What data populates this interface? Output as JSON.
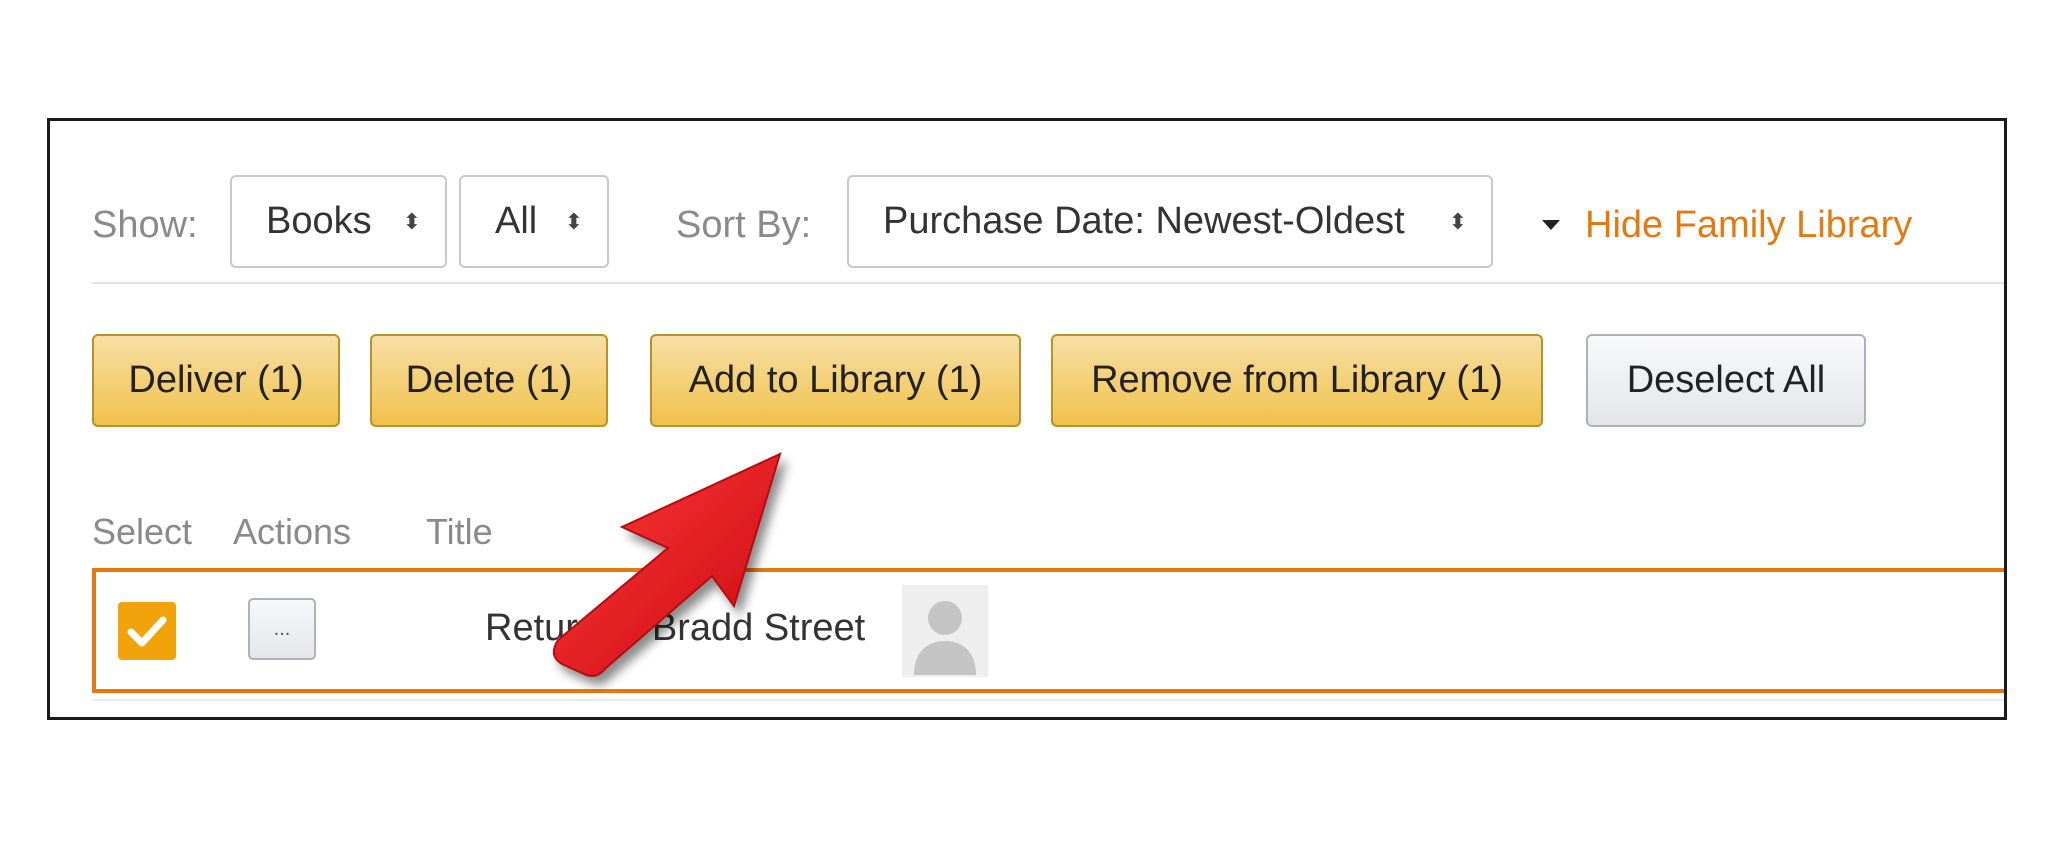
{
  "filters": {
    "show_label": "Show:",
    "type_select": {
      "value": "Books",
      "arrows": "⬍"
    },
    "scope_select": {
      "value": "All",
      "arrows": "⬍"
    },
    "sort_label": "Sort By:",
    "sort_select": {
      "value": "Purchase Date: Newest-Oldest",
      "arrows": "⬍"
    },
    "family_link": "Hide Family Library"
  },
  "toolbar": {
    "deliver": "Deliver (1)",
    "delete": "Delete (1)",
    "add_to_library": "Add to Library (1)",
    "remove_from_library": "Remove from Library (1)",
    "deselect_all": "Deselect All"
  },
  "table": {
    "columns": [
      "Select",
      "Actions",
      "Title"
    ],
    "rows": [
      {
        "selected": true,
        "actions_label": "...",
        "title": "Return to Bradd Street"
      }
    ]
  },
  "colors": {
    "accent": "#e47911",
    "button_yellow": "#f0c14b",
    "checkbox": "#f0a30a",
    "annotation_arrow": "#e8141c"
  },
  "icons": {
    "checkbox": "checkmark-icon",
    "avatar": "person-placeholder-icon",
    "caret": "caret-down-icon",
    "annotation": "red-pointer-arrow-icon"
  }
}
